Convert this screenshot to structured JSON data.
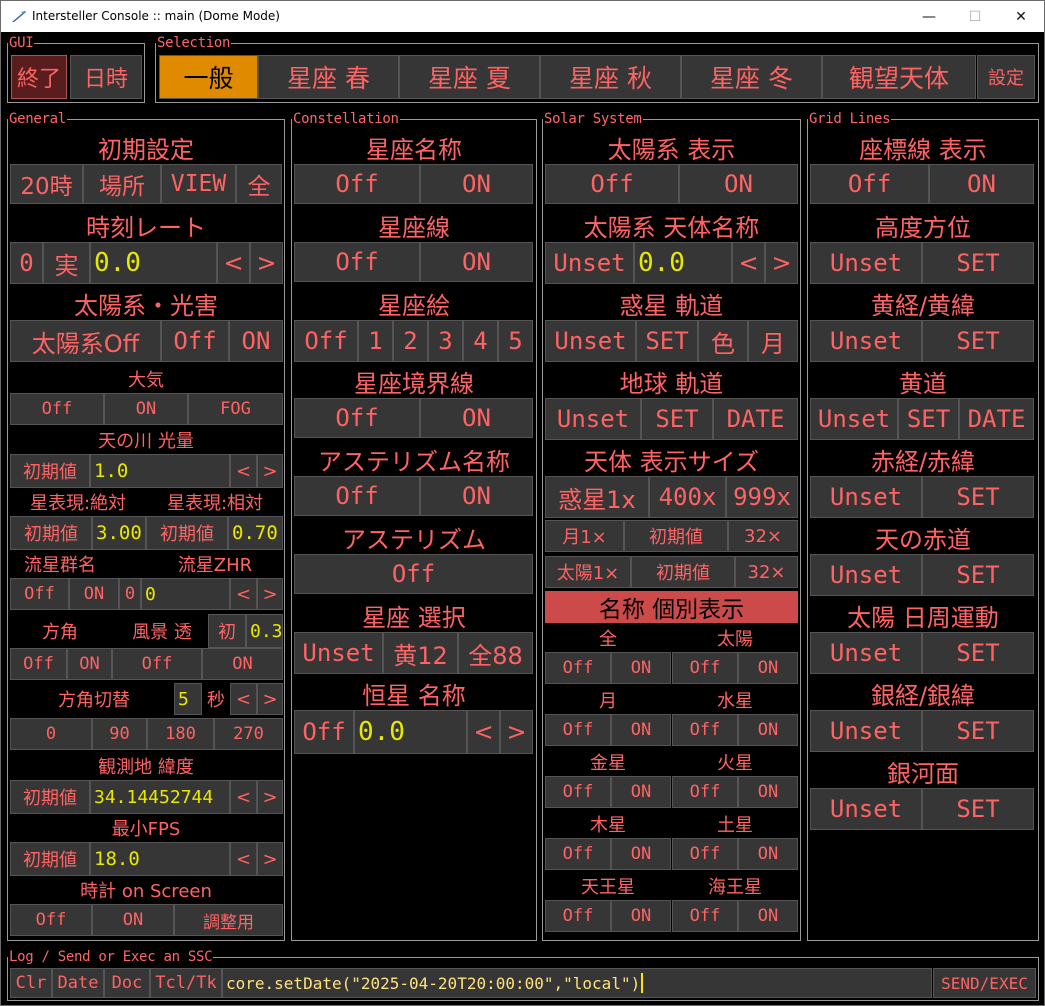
{
  "window": {
    "title": "Intersteller Console :: main (Dome Mode)",
    "min": "—",
    "max": "☐",
    "close": "✕"
  },
  "gui": {
    "label": "GUI",
    "quit": "終了",
    "datetime": "日時"
  },
  "selection": {
    "label": "Selection",
    "tabs": [
      "一般",
      "星座 春",
      "星座 夏",
      "星座 秋",
      "星座 冬",
      "観望天体"
    ],
    "settings": "設定"
  },
  "general": {
    "label": "General",
    "init_title": "初期設定",
    "init_buttons": [
      "20時",
      "場所",
      "VIEW",
      "全"
    ],
    "time_rate_title": "時刻レート",
    "time_rate": {
      "zero": "0",
      "real": "実",
      "value": "0.0",
      "prev": "<",
      "next": ">"
    },
    "solar_light_title": "太陽系・光害",
    "solar_light_buttons": [
      "太陽系Off",
      "Off",
      "ON"
    ],
    "atmosphere_title": "大気",
    "atmosphere_buttons": [
      "Off",
      "ON",
      "FOG"
    ],
    "milkyway_title": "天の川 光量",
    "milkyway": {
      "reset": "初期値",
      "value": "1.0",
      "prev": "<",
      "next": ">"
    },
    "star_abs_title": "星表現:絶対",
    "star_rel_title": "星表現:相対",
    "star_abs": {
      "reset": "初期値",
      "value": "3.00"
    },
    "star_rel": {
      "reset": "初期値",
      "value": "0.70"
    },
    "meteor_name_title": "流星群名",
    "meteor_zhr_title": "流星ZHR",
    "meteor": {
      "off": "Off",
      "on": "ON",
      "zero": "0",
      "value": "0",
      "prev": "<",
      "next": ">"
    },
    "cardinal_title": "方角",
    "landscape_title": "風景 透",
    "landscape": {
      "init": "初",
      "value": "0.3"
    },
    "cardinal_buttons": [
      "Off",
      "ON"
    ],
    "landscape_buttons": [
      "Off",
      "ON"
    ],
    "az_switch_title": "方角切替",
    "az_switch": {
      "value": "5",
      "unit": "秒",
      "prev": "<",
      "next": ">"
    },
    "az_buttons": [
      "0",
      "90",
      "180",
      "270"
    ],
    "latitude_title": "観測地 緯度",
    "latitude": {
      "reset": "初期値",
      "value": "34.14452744",
      "prev": "<",
      "next": ">"
    },
    "fps_title": "最小FPS",
    "fps": {
      "reset": "初期値",
      "value": "18.0",
      "prev": "<",
      "next": ">"
    },
    "clock_title": "時計 on Screen",
    "clock_buttons": [
      "Off",
      "ON",
      "調整用"
    ]
  },
  "constellation": {
    "label": "Constellation",
    "name_title": "星座名称",
    "name_buttons": [
      "Off",
      "ON"
    ],
    "lines_title": "星座線",
    "lines_buttons": [
      "Off",
      "ON"
    ],
    "art_title": "星座絵",
    "art_buttons": [
      "Off",
      "1",
      "2",
      "3",
      "4",
      "5"
    ],
    "boundary_title": "星座境界線",
    "boundary_buttons": [
      "Off",
      "ON"
    ],
    "asterism_name_title": "アステリズム名称",
    "asterism_name_buttons": [
      "Off",
      "ON"
    ],
    "asterism_title": "アステリズム",
    "asterism_button": "Off",
    "select_title": "星座 選択",
    "select_buttons": [
      "Unset",
      "黄12",
      "全88"
    ],
    "star_name_title": "恒星 名称",
    "star_name": {
      "off": "Off",
      "value": "0.0",
      "prev": "<",
      "next": ">"
    }
  },
  "solar": {
    "label": "Solar System",
    "show_title": "太陽系 表示",
    "show_buttons": [
      "Off",
      "ON"
    ],
    "names_title": "太陽系 天体名称",
    "names": {
      "unset": "Unset",
      "value": "0.0",
      "prev": "<",
      "next": ">"
    },
    "planet_orbit_title": "惑星 軌道",
    "planet_orbit_buttons": [
      "Unset",
      "SET",
      "色",
      "月"
    ],
    "earth_orbit_title": "地球 軌道",
    "earth_orbit_buttons": [
      "Unset",
      "SET",
      "DATE"
    ],
    "size_title": "天体 表示サイズ",
    "size_row1": [
      "惑星1x",
      "400x",
      "999x"
    ],
    "size_row2": [
      "月1×",
      "初期値",
      "32×"
    ],
    "size_row3": [
      "太陽1×",
      "初期値",
      "32×"
    ],
    "individual_title": "名称 個別表示",
    "bodies": [
      {
        "name": "全",
        "off": "Off",
        "on": "ON"
      },
      {
        "name": "太陽",
        "off": "Off",
        "on": "ON"
      },
      {
        "name": "月",
        "off": "Off",
        "on": "ON"
      },
      {
        "name": "水星",
        "off": "Off",
        "on": "ON"
      },
      {
        "name": "金星",
        "off": "Off",
        "on": "ON"
      },
      {
        "name": "火星",
        "off": "Off",
        "on": "ON"
      },
      {
        "name": "木星",
        "off": "Off",
        "on": "ON"
      },
      {
        "name": "土星",
        "off": "Off",
        "on": "ON"
      },
      {
        "name": "天王星",
        "off": "Off",
        "on": "ON"
      },
      {
        "name": "海王星",
        "off": "Off",
        "on": "ON"
      }
    ]
  },
  "grid": {
    "label": "Grid Lines",
    "show_title": "座標線 表示",
    "show_buttons": [
      "Off",
      "ON"
    ],
    "altaz_title": "高度方位",
    "altaz_buttons": [
      "Unset",
      "SET"
    ],
    "ecliptic_coord_title": "黄経/黄緯",
    "ecliptic_coord_buttons": [
      "Unset",
      "SET"
    ],
    "ecliptic_title": "黄道",
    "ecliptic_buttons": [
      "Unset",
      "SET",
      "DATE"
    ],
    "equatorial_title": "赤経/赤緯",
    "equatorial_buttons": [
      "Unset",
      "SET"
    ],
    "celestial_eq_title": "天の赤道",
    "celestial_eq_buttons": [
      "Unset",
      "SET"
    ],
    "sun_diurnal_title": "太陽 日周運動",
    "sun_diurnal_buttons": [
      "Unset",
      "SET"
    ],
    "galactic_title": "銀経/銀緯",
    "galactic_buttons": [
      "Unset",
      "SET"
    ],
    "galactic_plane_title": "銀河面",
    "galactic_plane_buttons": [
      "Unset",
      "SET"
    ]
  },
  "log": {
    "label": "Log / Send or Exec an SSC",
    "buttons": [
      "Clr",
      "Date",
      "Doc",
      "Tcl/Tk"
    ],
    "command": "core.setDate(\"2025-04-20T20:00:00\",\"local\")",
    "send": "SEND/EXEC"
  }
}
